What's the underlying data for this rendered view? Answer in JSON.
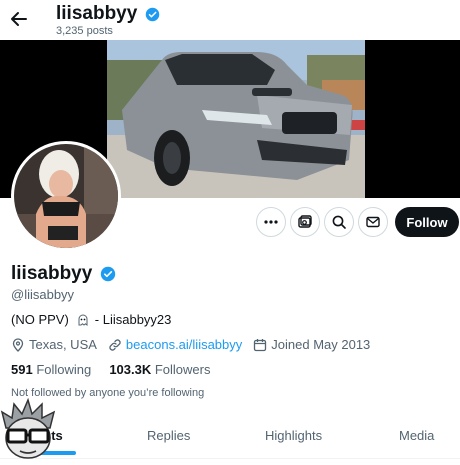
{
  "header": {
    "title": "liisabbyy",
    "posts_count": "3,235 posts"
  },
  "profile": {
    "name": "liisabbyy",
    "handle": "@liisabbyy",
    "bio_prefix": "(NO PPV)",
    "bio_suffix": "- Liisabbyy23",
    "location": "Texas, USA",
    "website": "beacons.ai/liisabbyy",
    "joined": "Joined May 2013",
    "following_count": "591",
    "following_label": "Following",
    "followers_count": "103.3K",
    "followers_label": "Followers",
    "follow_note": "Not followed by anyone you’re following"
  },
  "actions": {
    "follow_label": "Follow",
    "more_icon": "more-icon",
    "subscribe_icon": "subscribe-icon",
    "search_icon": "search-icon",
    "message_icon": "message-icon"
  },
  "tabs": [
    {
      "label": "sts",
      "active": true
    },
    {
      "label": "Replies",
      "active": false
    },
    {
      "label": "Highlights",
      "active": false
    },
    {
      "label": "Media",
      "active": false
    }
  ],
  "colors": {
    "accent": "#1d9bf0",
    "text": "#0f1419",
    "secondary": "#536471",
    "follow_bg": "#0f1419"
  }
}
